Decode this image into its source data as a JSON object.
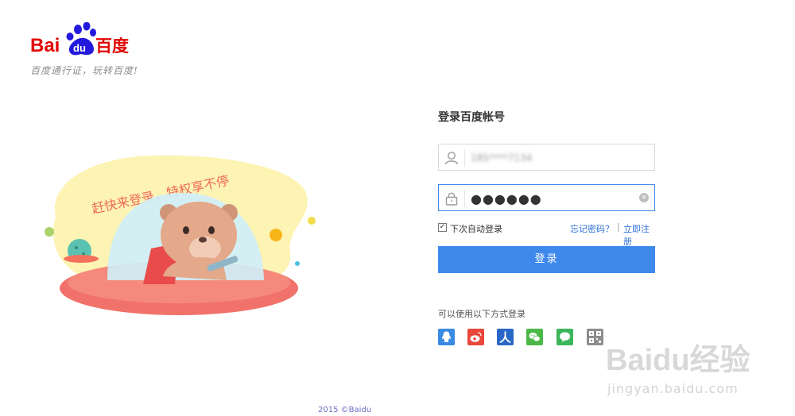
{
  "logo": {
    "brand_latin": "Bai",
    "brand_paw": "du",
    "brand_cn": "百度",
    "slogan": "百度通行证，玩转百度!"
  },
  "illustration": {
    "banner_text": "赶快来登录，特权享不停"
  },
  "login": {
    "title": "登录百度帐号",
    "username": {
      "value": "185****7134",
      "icon": "user-icon"
    },
    "password": {
      "value": "●●●●●●",
      "icon": "lock-icon",
      "clear_glyph": "×"
    },
    "remember_label": "下次自动登录",
    "remember_checked": true,
    "forgot_link": "忘记密码？",
    "separator": "|",
    "register_link": "立即注册",
    "submit_label": "登录"
  },
  "other_login": {
    "title": "可以使用以下方式登录",
    "providers": [
      {
        "name": "qq-icon",
        "color": "#3a8ae3"
      },
      {
        "name": "weibo-icon",
        "color": "#e8473b"
      },
      {
        "name": "renren-icon",
        "color": "#2a66c6"
      },
      {
        "name": "wechat-icon",
        "color": "#4cb848"
      },
      {
        "name": "feixin-icon",
        "color": "#3bb65a"
      },
      {
        "name": "qrcode-icon",
        "color": "#8d8d8d"
      }
    ]
  },
  "footer": {
    "copyright": "2015 ©Baidu"
  },
  "watermark": {
    "brand": "Baidu经验",
    "url": "jingyan.baidu.com"
  }
}
